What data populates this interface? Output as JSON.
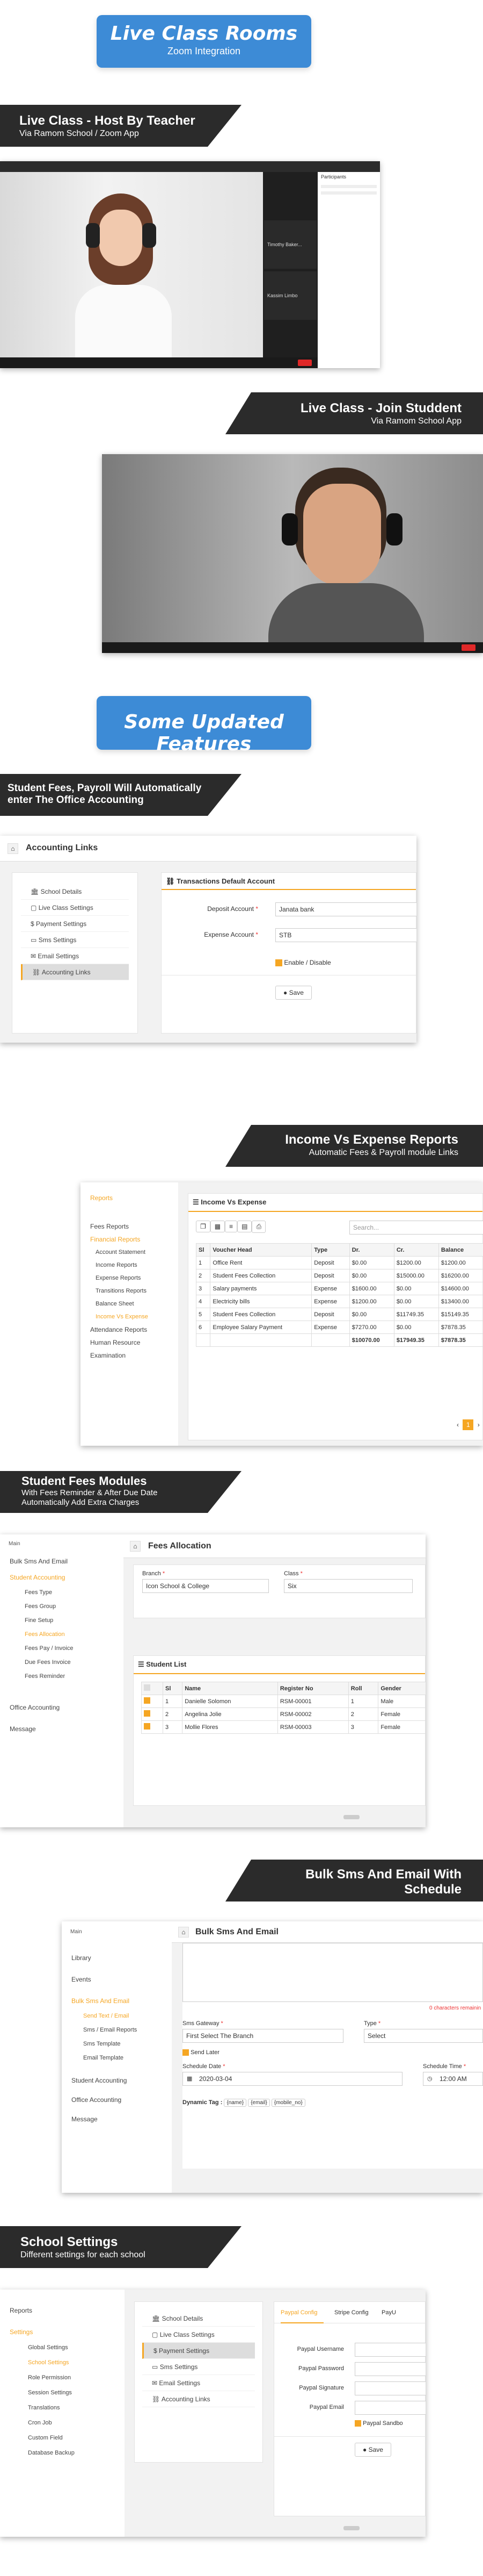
{
  "pill1": {
    "title": "Live Class Rooms",
    "subtitle": "Zoom Integration"
  },
  "banner1": {
    "title": "Live Class - Host By Teacher",
    "subtitle": "Via Ramom School / Zoom App"
  },
  "banner2": {
    "title": "Live Class - Join Studdent",
    "subtitle": "Via Ramom School  App"
  },
  "zoom1": {
    "panel_title": "Participants",
    "tile1": "Timothy  Baker...",
    "tile2": "Kassim Limbo"
  },
  "pill2": {
    "title": "Some Updated Features"
  },
  "banner3": {
    "line1": "Student Fees, Payroll Will Automatically",
    "line2": "enter The Office Accounting"
  },
  "accounting": {
    "title": "Accounting Links",
    "menu": [
      "School Details",
      "Live Class Settings",
      "Payment Settings",
      "Sms Settings",
      "Email Settings",
      "Accounting Links"
    ],
    "panel_title": "Transactions Default Account",
    "deposit_label": "Deposit Account",
    "deposit_value": "Janata bank",
    "expense_label": "Expense Account",
    "expense_value": "STB",
    "toggle_label": "Enable / Disable",
    "save": "Save"
  },
  "banner4": {
    "title": "Income Vs Expense Reports",
    "subtitle": "Automatic Fees & Payroll module Links"
  },
  "reports": {
    "menu_top": "Reports",
    "menu": [
      "Fees Reports",
      "Financial Reports",
      "Account Statement",
      "Income Reports",
      "Expense Reports",
      "Transitions Reports",
      "Balance Sheet",
      "Income Vs Expense",
      "Attendance Reports",
      "Human Resource",
      "Examination"
    ],
    "title": "Income Vs Expense",
    "search_placeholder": "Search...",
    "columns": [
      "Sl",
      "Voucher Head",
      "Type",
      "Dr.",
      "Cr.",
      "Balance"
    ],
    "rows": [
      [
        "1",
        "Office Rent",
        "Deposit",
        "$0.00",
        "$1200.00",
        "$1200.00"
      ],
      [
        "2",
        "Student Fees Collection",
        "Deposit",
        "$0.00",
        "$15000.00",
        "$16200.00"
      ],
      [
        "3",
        "Salary payments",
        "Expense",
        "$1600.00",
        "$0.00",
        "$14600.00"
      ],
      [
        "4",
        "Electricity bills",
        "Expense",
        "$1200.00",
        "$0.00",
        "$13400.00"
      ],
      [
        "5",
        "Student Fees Collection",
        "Deposit",
        "$0.00",
        "$11749.35",
        "$15149.35"
      ],
      [
        "6",
        "Employee Salary Payment",
        "Expense",
        "$7270.00",
        "$0.00",
        "$7878.35"
      ]
    ],
    "totals": [
      "",
      "",
      "",
      "$10070.00",
      "$17949.35",
      "$7878.35"
    ],
    "page": "1"
  },
  "banner5": {
    "title": "Student Fees Modules",
    "line2": "With Fees Reminder & After Due Date",
    "line3": "Automatically Add Extra Charges"
  },
  "fees": {
    "header": "Main",
    "menu": [
      "Bulk Sms And Email",
      "Student Accounting",
      "Fees Type",
      "Fees Group",
      "Fine Setup",
      "Fees Allocation",
      "Fees Pay / Invoice",
      "Due Fees Invoice",
      "Fees Reminder",
      "Office Accounting",
      "Message"
    ],
    "title": "Fees Allocation",
    "branch_label": "Branch",
    "branch_value": "Icon School & College",
    "class_label": "Class",
    "class_value": "Six",
    "list_title": "Student List",
    "columns": [
      "",
      "Sl",
      "Name",
      "Register No",
      "Roll",
      "Gender"
    ],
    "rows": [
      [
        "1",
        "Danielle Solomon",
        "RSM-00001",
        "1",
        "Male"
      ],
      [
        "2",
        "Angelina Jolie",
        "RSM-00002",
        "2",
        "Female"
      ],
      [
        "3",
        "Mollie Flores",
        "RSM-00003",
        "3",
        "Female"
      ]
    ]
  },
  "banner6": {
    "line1": "Bulk Sms And Email With",
    "line2": "Schedule"
  },
  "bulk": {
    "header": "Main",
    "menu": [
      "Library",
      "Events",
      "Bulk Sms And Email",
      "Send Text / Email",
      "Sms / Email Reports",
      "Sms Template",
      "Email Template",
      "Student Accounting",
      "Office Accounting",
      "Message"
    ],
    "title": "Bulk Sms And Email",
    "char_note": "0 characters remainin",
    "gateway_label": "Sms Gateway",
    "gateway_value": "First Select The Branch",
    "type_label": "Type",
    "type_value": "Select",
    "send_later": "Send Later",
    "date_label": "Schedule Date",
    "date_value": "2020-03-04",
    "time_label": "Schedule Time",
    "time_value": "12:00 AM",
    "tags_label": "Dynamic Tag :",
    "tags": [
      "{name}",
      "{email}",
      "{mobile_no}"
    ]
  },
  "banner7": {
    "title": "School Settings",
    "subtitle": "Different settings for each school"
  },
  "settings": {
    "menu_left": [
      "Reports",
      "Settings",
      "Global Settings",
      "School Settings",
      "Role Permission",
      "Session Settings",
      "Translations",
      "Cron Job",
      "Custom Field",
      "Database Backup"
    ],
    "menu_mid": [
      "School Details",
      "Live Class Settings",
      "Payment Settings",
      "Sms Settings",
      "Email Settings",
      "Accounting Links"
    ],
    "tabs": [
      "Paypal Config",
      "Stripe Config",
      "PayU"
    ],
    "fields": [
      "Paypal Username",
      "Paypal Password",
      "Paypal Signature",
      "Paypal Email"
    ],
    "sandbox": "Paypal Sandbo",
    "save": "Save"
  }
}
